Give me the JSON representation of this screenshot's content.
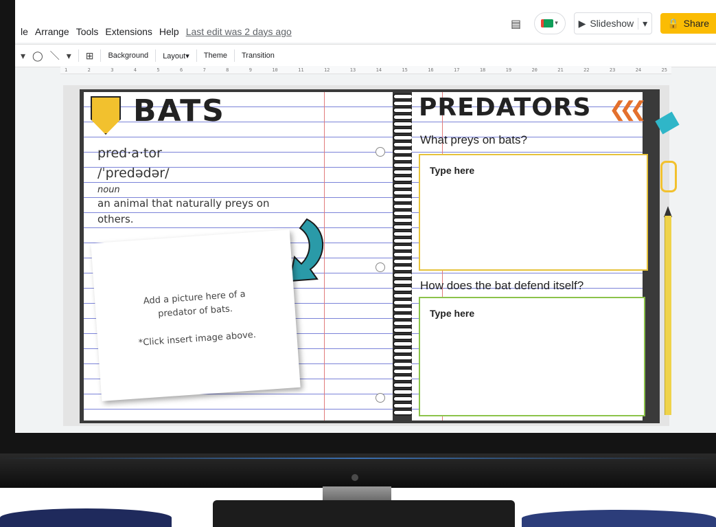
{
  "menubar": {
    "items": [
      "le",
      "Arrange",
      "Tools",
      "Extensions",
      "Help"
    ],
    "last_edit": "Last edit was 2 days ago",
    "slideshow_label": "Slideshow",
    "share_label": "Share"
  },
  "toolbar": {
    "background_label": "Background",
    "layout_label": "Layout",
    "theme_label": "Theme",
    "transition_label": "Transition"
  },
  "ruler": {
    "ticks": [
      "1",
      "2",
      "3",
      "4",
      "5",
      "6",
      "7",
      "8",
      "9",
      "10",
      "11",
      "12",
      "13",
      "14",
      "15",
      "16",
      "17",
      "18",
      "19",
      "20",
      "21",
      "22",
      "23",
      "24",
      "25"
    ]
  },
  "slide": {
    "left_title": "BATS",
    "word": "pred·a·tor",
    "pronunciation": "/ˈpredədər/",
    "part_of_speech": "noun",
    "definition_1": "an animal that naturally preys on",
    "definition_2": "others.",
    "photo_prompt_1": "Add a picture here of a",
    "photo_prompt_2": "predator of bats.",
    "photo_note": "*Click insert image above.",
    "right_title": "PREDATORS",
    "question_1": "What preys on bats?",
    "answer_1": "Type here",
    "question_2": "How does the bat defend itself?",
    "answer_2": "Type here"
  },
  "colors": {
    "share_button": "#fbbc04",
    "banner": "#f2c12e",
    "box1_border": "#e6c23a",
    "box2_border": "#8bc34a",
    "arrow": "#2a9aa8",
    "chevrons": "#e3702d"
  },
  "icons": [
    "comment-icon",
    "meet-icon",
    "slideshow-icon",
    "lock-icon",
    "shape-icon",
    "line-icon",
    "textbox-icon"
  ]
}
